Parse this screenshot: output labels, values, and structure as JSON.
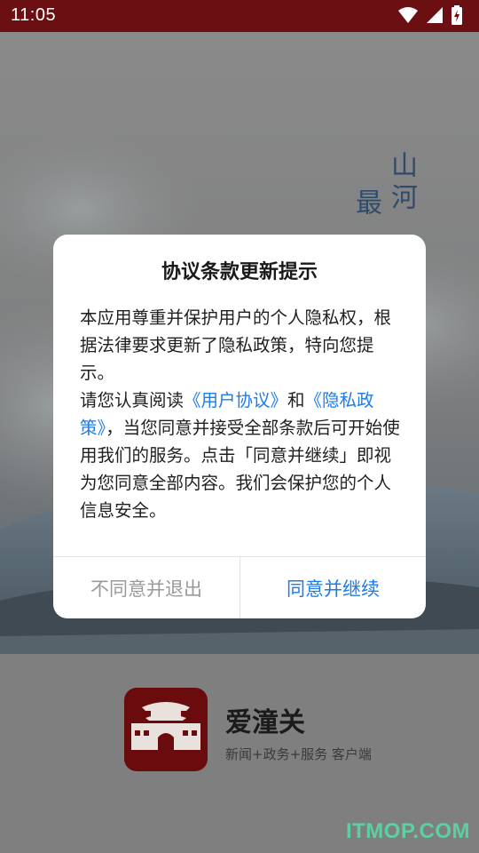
{
  "status_bar": {
    "time": "11:05",
    "icons": [
      "wifi-icon",
      "cellular-signal-icon",
      "battery-charging-icon"
    ],
    "background_color": "#6c0f12"
  },
  "splash": {
    "poem_col_1": "山河",
    "poem_col_2": "最"
  },
  "dialog": {
    "title": "协议条款更新提示",
    "paragraph_1": "本应用尊重并保护用户的个人隐私权，根据法律要求更新了隐私政策，特向您提示。",
    "paragraph_2_prefix": "请您认真阅读",
    "user_agreement_link": "《用户协议》",
    "and": "和",
    "privacy_policy_link": "《隐私政策》",
    "paragraph_2_suffix": "，当您同意并接受全部条款后可开始使用我们的服务。点击「同意并继续」即视为您同意全部内容。我们会保护您的个人信息安全。",
    "disagree_button": "不同意并退出",
    "agree_button": "同意并继续",
    "link_color": "#1e7ce8"
  },
  "brand": {
    "app_name": "爱潼关",
    "slogan": "新闻+政务+服务 客户端",
    "logo_color": "#6a0c0e"
  },
  "watermark": "ITMOP.COM"
}
